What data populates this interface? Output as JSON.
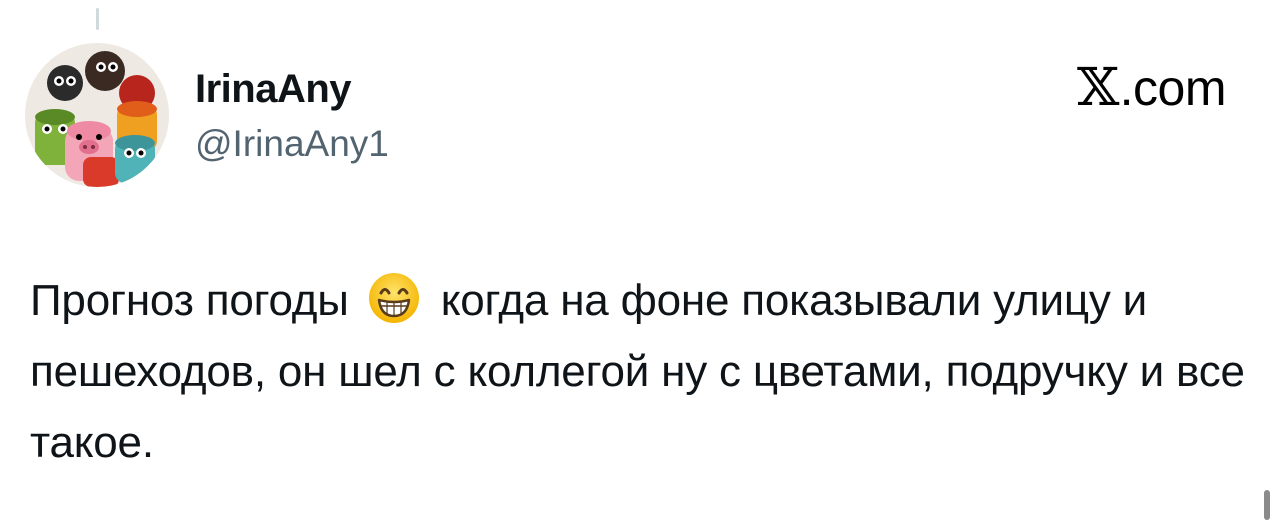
{
  "tweet": {
    "author": {
      "display_name": "IrinaAny",
      "handle": "@IrinaAny1",
      "avatar_icon": "crochet-toys-avatar"
    },
    "brand": {
      "mark": "𝕏",
      "suffix": ".com"
    },
    "text_before_emoji": "Прогноз погоды",
    "emoji_icon": "grinning-face-emoji",
    "text_after_emoji": "когда на фоне показывали улицу и пешеходов, он шел с коллегой ну с цветами, подручку и все такое."
  },
  "colors": {
    "text": "#0f1419",
    "secondary_text": "#536471",
    "background": "#ffffff"
  }
}
